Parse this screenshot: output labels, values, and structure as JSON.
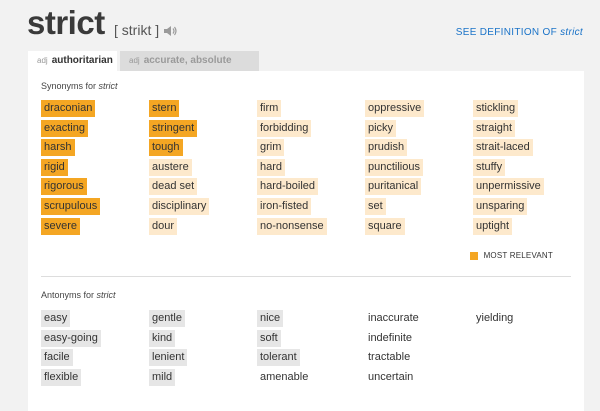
{
  "header": {
    "word": "strict",
    "pronunciation": "[ strikt ]",
    "speaker_icon": "speaker-icon",
    "see_definition_prefix": "SEE DEFINITION OF",
    "see_definition_word": "strict"
  },
  "tabs": [
    {
      "pos": "adj",
      "label": "authoritarian",
      "active": true
    },
    {
      "pos": "adj",
      "label": "accurate, absolute",
      "active": false
    }
  ],
  "synonyms": {
    "title_prefix": "Synonyms for",
    "title_word": "strict",
    "columns": [
      [
        {
          "text": "draconian",
          "relevance": 3
        },
        {
          "text": "exacting",
          "relevance": 3
        },
        {
          "text": "harsh",
          "relevance": 3
        },
        {
          "text": "rigid",
          "relevance": 3
        },
        {
          "text": "rigorous",
          "relevance": 3
        },
        {
          "text": "scrupulous",
          "relevance": 3
        },
        {
          "text": "severe",
          "relevance": 3
        }
      ],
      [
        {
          "text": "stern",
          "relevance": 3
        },
        {
          "text": "stringent",
          "relevance": 3
        },
        {
          "text": "tough",
          "relevance": 3
        },
        {
          "text": "austere",
          "relevance": 2
        },
        {
          "text": "dead set",
          "relevance": 2
        },
        {
          "text": "disciplinary",
          "relevance": 2
        },
        {
          "text": "dour",
          "relevance": 2
        }
      ],
      [
        {
          "text": "firm",
          "relevance": 2
        },
        {
          "text": "forbidding",
          "relevance": 2
        },
        {
          "text": "grim",
          "relevance": 2
        },
        {
          "text": "hard",
          "relevance": 2
        },
        {
          "text": "hard-boiled",
          "relevance": 2
        },
        {
          "text": "iron-fisted",
          "relevance": 2
        },
        {
          "text": "no-nonsense",
          "relevance": 2
        }
      ],
      [
        {
          "text": "oppressive",
          "relevance": 2
        },
        {
          "text": "picky",
          "relevance": 2
        },
        {
          "text": "prudish",
          "relevance": 2
        },
        {
          "text": "punctilious",
          "relevance": 2
        },
        {
          "text": "puritanical",
          "relevance": 2
        },
        {
          "text": "set",
          "relevance": 2
        },
        {
          "text": "square",
          "relevance": 2
        }
      ],
      [
        {
          "text": "stickling",
          "relevance": 2
        },
        {
          "text": "straight",
          "relevance": 2
        },
        {
          "text": "strait-laced",
          "relevance": 2
        },
        {
          "text": "stuffy",
          "relevance": 2
        },
        {
          "text": "unpermissive",
          "relevance": 2
        },
        {
          "text": "unsparing",
          "relevance": 2
        },
        {
          "text": "uptight",
          "relevance": 2
        }
      ]
    ],
    "legend_label": "MOST RELEVANT"
  },
  "antonyms": {
    "title_prefix": "Antonyms for",
    "title_word": "strict",
    "columns": [
      [
        {
          "text": "easy",
          "relevance": 2
        },
        {
          "text": "easy-going",
          "relevance": 2
        },
        {
          "text": "facile",
          "relevance": 2
        },
        {
          "text": "flexible",
          "relevance": 2
        }
      ],
      [
        {
          "text": "gentle",
          "relevance": 2
        },
        {
          "text": "kind",
          "relevance": 2
        },
        {
          "text": "lenient",
          "relevance": 2
        },
        {
          "text": "mild",
          "relevance": 2
        }
      ],
      [
        {
          "text": "nice",
          "relevance": 2
        },
        {
          "text": "soft",
          "relevance": 2
        },
        {
          "text": "tolerant",
          "relevance": 2
        },
        {
          "text": "amenable",
          "relevance": 1
        }
      ],
      [
        {
          "text": "inaccurate",
          "relevance": 1
        },
        {
          "text": "indefinite",
          "relevance": 1
        },
        {
          "text": "tractable",
          "relevance": 1
        },
        {
          "text": "uncertain",
          "relevance": 1
        }
      ],
      [
        {
          "text": "yielding",
          "relevance": 1
        }
      ]
    ]
  },
  "colors": {
    "most_relevant": "#f4a623",
    "relevant": "#fde9cc",
    "antonym": "#e6e6e6",
    "link": "#1a73c8"
  }
}
